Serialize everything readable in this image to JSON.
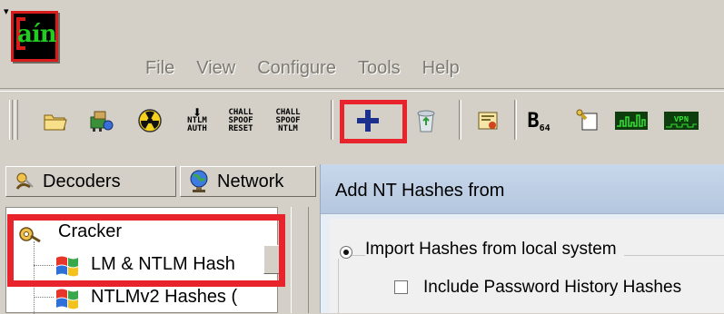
{
  "app": {
    "system_menu_glyph": "▾",
    "logo_text": "aín",
    "colors": {
      "logo_green": "#22cc22",
      "logo_red": "#d81c1c",
      "highlight": "#e8232b"
    }
  },
  "menu": {
    "items": [
      {
        "label": "File"
      },
      {
        "label": "View"
      },
      {
        "label": "Configure"
      },
      {
        "label": "Tools"
      },
      {
        "label": "Help"
      }
    ]
  },
  "toolbar": {
    "ntlm_auth": "NTLM\nAUTH",
    "chall_spoof_reset": "CHALL\nSPOOF\nRESET",
    "chall_spoof_ntlm": "CHALL\nSPOOF\nNTLM",
    "base64_b": "B",
    "base64_sub": "64",
    "icons": [
      "open-folder-icon",
      "network-adapter-icon",
      "radiation-icon",
      "ntlm-auth-icon",
      "chall-spoof-reset-icon",
      "chall-spoof-ntlm-icon",
      "add-icon",
      "recycle-bin-icon",
      "certificate-icon",
      "base64-icon",
      "script-icon",
      "signal-icon",
      "vpn-icon"
    ]
  },
  "left_panel": {
    "tabs": [
      {
        "label": "Decoders"
      },
      {
        "label": "Network"
      }
    ],
    "tree": {
      "root": "Cracker",
      "items": [
        {
          "label": "LM & NTLM Hash"
        },
        {
          "label": "NTLMv2 Hashes ("
        }
      ]
    }
  },
  "dialog": {
    "title": "Add NT Hashes from",
    "radio_label": "Import Hashes from local system",
    "checkbox_label": "Include Password History Hashes",
    "radio_selected": true,
    "checkbox_checked": false
  }
}
